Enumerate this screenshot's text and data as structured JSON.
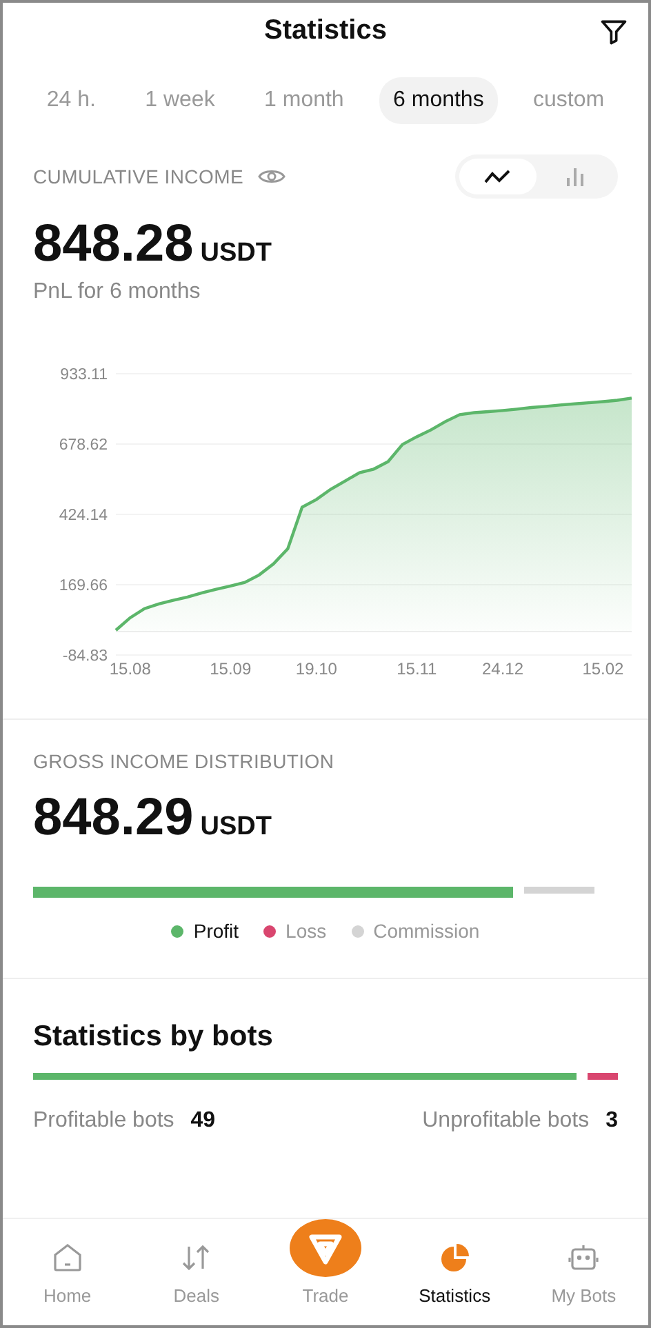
{
  "header": {
    "title": "Statistics"
  },
  "periods": [
    {
      "label": "24 h.",
      "selected": false
    },
    {
      "label": "1 week",
      "selected": false
    },
    {
      "label": "1 month",
      "selected": false
    },
    {
      "label": "6 months",
      "selected": true
    },
    {
      "label": "custom",
      "selected": false
    }
  ],
  "cumulative": {
    "label": "CUMULATIVE INCOME",
    "amount": "848.28",
    "currency": "USDT",
    "subtitle": "PnL for 6 months",
    "chart_modes": [
      {
        "kind": "line",
        "selected": true
      },
      {
        "kind": "bar",
        "selected": false
      }
    ],
    "chart_data": {
      "type": "area",
      "grid": true,
      "ylim": [
        -84.83,
        933.11
      ],
      "yticks": [
        933.11,
        678.62,
        424.14,
        169.66,
        -84.83
      ],
      "categories": [
        null,
        "15.08",
        null,
        null,
        null,
        null,
        null,
        null,
        "15.09",
        null,
        null,
        null,
        null,
        null,
        "19.10",
        null,
        null,
        null,
        null,
        null,
        null,
        "15.11",
        null,
        null,
        null,
        null,
        null,
        "24.12",
        null,
        null,
        null,
        null,
        null,
        null,
        "15.02",
        null,
        null
      ],
      "series": [
        {
          "color": "#5cb66a",
          "values": [
            5,
            50,
            83,
            100,
            113,
            125,
            140,
            153,
            165,
            178,
            205,
            245,
            300,
            450,
            478,
            515,
            545,
            575,
            588,
            615,
            677,
            705,
            730,
            760,
            785,
            792,
            796,
            800,
            805,
            811,
            815,
            820,
            824,
            828,
            832,
            837,
            845
          ]
        }
      ]
    }
  },
  "distribution": {
    "label": "GROSS INCOME DISTRIBUTION",
    "amount": "848.29",
    "currency": "USDT",
    "segments": [
      {
        "kind": "profit",
        "color": "#5cb66a"
      },
      {
        "kind": "commission",
        "color": "#d4d4d4"
      }
    ],
    "legend": [
      {
        "label": "Profit",
        "color": "#5cb66a",
        "active": true
      },
      {
        "label": "Loss",
        "color": "#d9466f",
        "active": false
      },
      {
        "label": "Commission",
        "color": "#d4d4d4",
        "active": false
      }
    ]
  },
  "bots": {
    "title": "Statistics by bots",
    "segments": [
      {
        "kind": "profitable",
        "color": "#5cb66a"
      },
      {
        "kind": "unprofitable",
        "color": "#d9466f"
      }
    ],
    "profitable": {
      "label": "Profitable bots",
      "value": "49"
    },
    "unprofitable": {
      "label": "Unprofitable bots",
      "value": "3"
    }
  },
  "nav": [
    {
      "kind": "home",
      "label": "Home",
      "selected": false
    },
    {
      "kind": "deals",
      "label": "Deals",
      "selected": false
    },
    {
      "kind": "trade",
      "label": "Trade",
      "selected": false
    },
    {
      "kind": "stats",
      "label": "Statistics",
      "selected": true
    },
    {
      "kind": "bots",
      "label": "My Bots",
      "selected": false
    }
  ]
}
